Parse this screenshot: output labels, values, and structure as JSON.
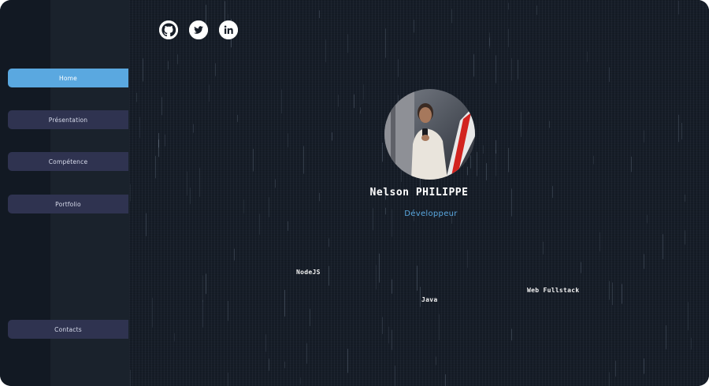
{
  "nav": {
    "items": [
      {
        "label": "Home",
        "active": true
      },
      {
        "label": "Présentation",
        "active": false
      },
      {
        "label": "Compétence",
        "active": false
      },
      {
        "label": "Portfolio",
        "active": false
      }
    ],
    "contact": {
      "label": "Contacts"
    }
  },
  "socials": [
    {
      "icon": "github-icon"
    },
    {
      "icon": "twitter-icon"
    },
    {
      "icon": "linkedin-icon"
    }
  ],
  "profile": {
    "name": "Nelson PHILIPPE",
    "role": "Développeur"
  },
  "skills": [
    {
      "label": "NodeJS"
    },
    {
      "label": "Java"
    },
    {
      "label": "Web Fullstack"
    }
  ],
  "colors": {
    "accent": "#5aa8e0",
    "nav_button": "#2f3350",
    "background": "#161d28",
    "sidebar": "#1a222c"
  }
}
